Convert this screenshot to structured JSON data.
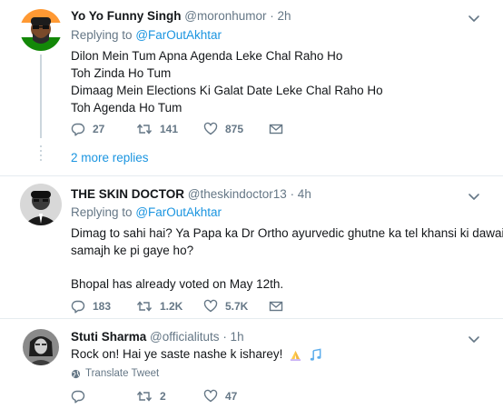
{
  "tweets": [
    {
      "name": "Yo Yo Funny Singh",
      "handle": "@moronhumor",
      "time": "· 2h",
      "replying_label": "Replying to",
      "replying_handle": "@FarOutAkhtar",
      "lines": [
        "Dilon Mein Tum Apna Agenda Leke Chal Raho Ho",
        "Toh Zinda Ho Tum",
        "Dimaag Mein Elections Ki Galat Date Leke Chal Raho Ho",
        "Toh Agenda Ho Tum"
      ],
      "replies": "27",
      "retweets": "141",
      "likes": "875",
      "more_replies": "2 more replies"
    },
    {
      "name": "THE SKIN DOCTOR",
      "handle": "@theskindoctor13",
      "time": "· 4h",
      "replying_label": "Replying to",
      "replying_handle": "@FarOutAkhtar",
      "lines": [
        "Dimag to sahi hai? Ya Papa ka Dr Ortho ayurvedic ghutne ka tel khansi ki dawai",
        "samajh ke pi gaye ho?",
        "Bhopal has already voted on May 12th."
      ],
      "replies": "183",
      "retweets": "1.2K",
      "likes": "5.7K"
    },
    {
      "name": "Stuti Sharma",
      "handle": "@officialituts",
      "time": "· 1h",
      "text": "Rock on! Hai ye saste nashe k isharey!",
      "emoji_icons": [
        "folded-hands-icon",
        "musical-notes-icon"
      ],
      "translate_label": "Translate Tweet",
      "replies": "",
      "retweets": "2",
      "likes": "47"
    }
  ],
  "colors": {
    "link": "#1b95e0",
    "muted": "#657786",
    "text": "#14171a",
    "divider": "#e6ecf0",
    "thread": "#ccd6dd"
  }
}
